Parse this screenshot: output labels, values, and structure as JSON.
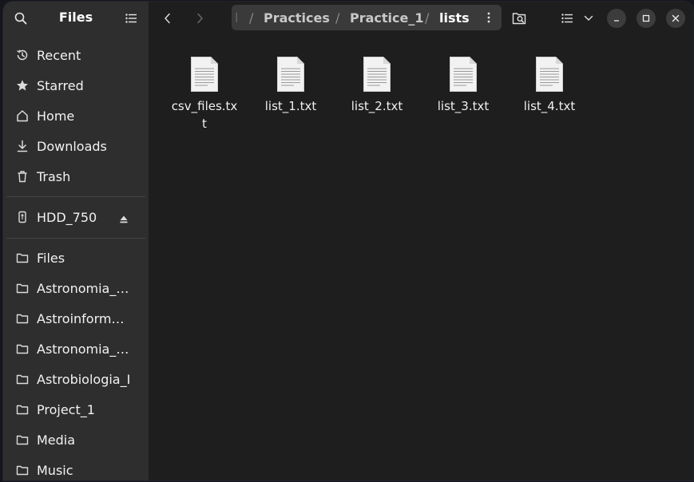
{
  "sidebar": {
    "title": "Files",
    "places": [
      {
        "label": "Recent",
        "icon": "clock-icon"
      },
      {
        "label": "Starred",
        "icon": "star-icon"
      },
      {
        "label": "Home",
        "icon": "home-icon"
      },
      {
        "label": "Downloads",
        "icon": "download-icon"
      },
      {
        "label": "Trash",
        "icon": "trash-icon"
      }
    ],
    "devices": [
      {
        "label": "HDD_750",
        "icon": "usb-drive-icon"
      }
    ],
    "bookmarks": [
      {
        "label": "Files"
      },
      {
        "label": "Astronomia_A..."
      },
      {
        "label": "Astroinformati..."
      },
      {
        "label": "Astronomia_O..."
      },
      {
        "label": "Astrobiologia_I"
      },
      {
        "label": "Project_1"
      },
      {
        "label": "Media"
      },
      {
        "label": "Music"
      }
    ]
  },
  "header": {
    "path": {
      "fragment": "l",
      "crumbs": [
        "Practices",
        "Practice_1",
        "lists"
      ],
      "separator": "/"
    }
  },
  "files": [
    {
      "name": "csv_files.txt"
    },
    {
      "name": "list_1.txt"
    },
    {
      "name": "list_2.txt"
    },
    {
      "name": "list_3.txt"
    },
    {
      "name": "list_4.txt"
    }
  ],
  "colors": {
    "sidebar_bg": "#2e2e2e",
    "content_bg": "#1e1e1e",
    "pathbar_bg": "#3a3a3a"
  }
}
